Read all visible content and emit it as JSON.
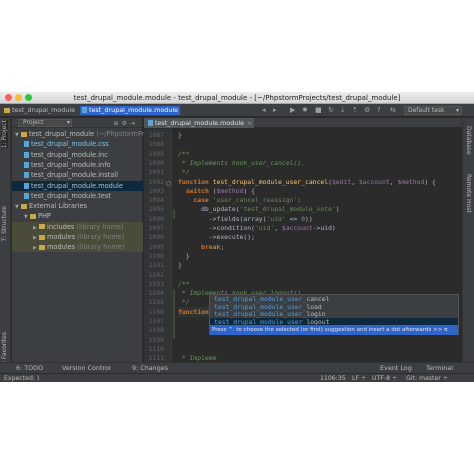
{
  "window": {
    "title": "test_drupal_module.module - test_drupal_module - [~/PhpstormProjects/test_drupal_module]"
  },
  "navbar": {
    "crumb_project": "test_drupal_module",
    "crumb_file": "test_drupal_module.module",
    "run_config": "Default task"
  },
  "left_strip": {
    "project_tab": "1: Project",
    "structure_tab": "7: Structure",
    "favorites_tab": "2: Favorites"
  },
  "right_strip": {
    "database_tab": "Database",
    "remote_host_tab": "Remote Host"
  },
  "project_panel": {
    "view_combo": "Project",
    "tree": [
      {
        "label": "test_drupal_module",
        "note": "(~/PhpstormProject",
        "kind": "folder",
        "depth": 0
      },
      {
        "label": "test_drupal_module.css",
        "kind": "file",
        "depth": 1
      },
      {
        "label": "test_drupal_module.inc",
        "kind": "file",
        "depth": 1
      },
      {
        "label": "test_drupal_module.info",
        "kind": "file",
        "depth": 1
      },
      {
        "label": "test_drupal_module.install",
        "kind": "file",
        "depth": 1
      },
      {
        "label": "test_drupal_module.module",
        "kind": "file",
        "depth": 1
      },
      {
        "label": "test_drupal_module.test",
        "kind": "file",
        "depth": 1
      },
      {
        "label": "External Libraries",
        "kind": "folder",
        "depth": 0
      },
      {
        "label": "PHP",
        "kind": "folder",
        "depth": 1
      },
      {
        "label": "includes",
        "note": "(library home)",
        "kind": "folder",
        "depth": 2
      },
      {
        "label": "modules",
        "note": "(library home)",
        "kind": "folder",
        "depth": 2
      },
      {
        "label": "modules",
        "note": "(library home)",
        "kind": "folder",
        "depth": 2
      }
    ]
  },
  "editor": {
    "tab_label": "test_drupal_module.module",
    "line_numbers": [
      "1087",
      "1088",
      "1089",
      "1090",
      "1091",
      "1092",
      "1093",
      "1094",
      "1095",
      "1096",
      "1097",
      "1098",
      "1099",
      "1100",
      "1101",
      "1102",
      "1103",
      "1104",
      "1105",
      "1106",
      "1107",
      "1108",
      "1109",
      "1110",
      "1111",
      "1112",
      "1113"
    ],
    "lines": [
      [
        [
          "p",
          "}"
        ]
      ],
      [],
      [
        [
          "cm",
          "/**"
        ]
      ],
      [
        [
          "cm",
          " * Implements hook_user_cancel()."
        ]
      ],
      [
        [
          "cm",
          " */"
        ]
      ],
      [
        [
          "kw",
          "function "
        ],
        [
          "fn",
          "test_drupal_module_user_cancel"
        ],
        [
          "p",
          "("
        ],
        [
          "var",
          "$edit"
        ],
        [
          "p",
          ", "
        ],
        [
          "var",
          "$account"
        ],
        [
          "p",
          ", "
        ],
        [
          "var",
          "$method"
        ],
        [
          "p",
          ") {"
        ]
      ],
      [
        [
          "p",
          "  "
        ],
        [
          "kw",
          "switch "
        ],
        [
          "p",
          "("
        ],
        [
          "var",
          "$method"
        ],
        [
          "p",
          ") {"
        ]
      ],
      [
        [
          "p",
          "    "
        ],
        [
          "kw",
          "case "
        ],
        [
          "str",
          "'user_cancel_reassign'"
        ],
        [
          "p",
          ":"
        ]
      ],
      [
        [
          "p",
          "      db_update("
        ],
        [
          "str",
          "'test_drupal_module_vote'"
        ],
        [
          "p",
          ")"
        ]
      ],
      [
        [
          "p",
          "        ->fields(array("
        ],
        [
          "str",
          "'uid'"
        ],
        [
          "p",
          " => "
        ],
        [
          "num",
          "0"
        ],
        [
          "p",
          "))"
        ]
      ],
      [
        [
          "p",
          "        ->condition("
        ],
        [
          "str",
          "'uid'"
        ],
        [
          "p",
          ", "
        ],
        [
          "var",
          "$account"
        ],
        [
          "p",
          "->uid)"
        ]
      ],
      [
        [
          "p",
          "        ->execute();"
        ]
      ],
      [
        [
          "p",
          "      "
        ],
        [
          "kw",
          "break"
        ],
        [
          "p",
          ";"
        ]
      ],
      [
        [
          "p",
          "  }"
        ]
      ],
      [
        [
          "p",
          "}"
        ]
      ],
      [],
      [
        [
          "cm",
          "/**"
        ]
      ],
      [
        [
          "cm",
          " * Implements hook_user_logout()."
        ]
      ],
      [
        [
          "cm",
          " */"
        ]
      ],
      [
        [
          "kw",
          "function "
        ],
        [
          "p",
          "test_drupal_module_user_l"
        ]
      ],
      [],
      [],
      [],
      [],
      [
        [
          "cm",
          " * Impleme"
        ]
      ],
      [
        [
          "kw",
          "function "
        ],
        [
          "p",
          "test_drupal_module_user_delete("
        ],
        [
          "var",
          "$account"
        ],
        [
          "p",
          ") {"
        ]
      ],
      [
        [
          "p",
          "  db_delete("
        ],
        [
          "str",
          "'test_drupal_module_vote'"
        ],
        [
          "p",
          ")"
        ]
      ],
      [
        [
          "p",
          "    ->condition("
        ],
        [
          "str",
          "'uid'"
        ],
        [
          "p",
          ", "
        ],
        [
          "var",
          "$account"
        ],
        [
          "p",
          "->uid)"
        ]
      ]
    ]
  },
  "completion": {
    "items": [
      {
        "prefix": "test_drupal_module_user_",
        "rest": "cancel"
      },
      {
        "prefix": "test_drupal_module_user_",
        "rest": "load"
      },
      {
        "prefix": "test_drupal_module_user_",
        "rest": "login"
      },
      {
        "prefix": "test_drupal_module_user_",
        "rest": "logout"
      }
    ],
    "hint": "Press ^. to choose the selected (or first) suggestion and insert a dot afterwards  >>  π"
  },
  "tool_windows": {
    "todo": "6: TODO",
    "vcs": "Version Control",
    "changes": "9: Changes",
    "event_log": "Event Log",
    "terminal": "Terminal"
  },
  "status_bar": {
    "message": "Expected: )",
    "position": "1106:35",
    "line_sep": "LF ÷",
    "encoding": "UTF-8 ÷",
    "git": "Git: master ÷"
  },
  "colors": {
    "background": "#2b2b2b",
    "panel": "#3c3f41",
    "selection": "#0d293e",
    "accent": "#2f65ca"
  }
}
